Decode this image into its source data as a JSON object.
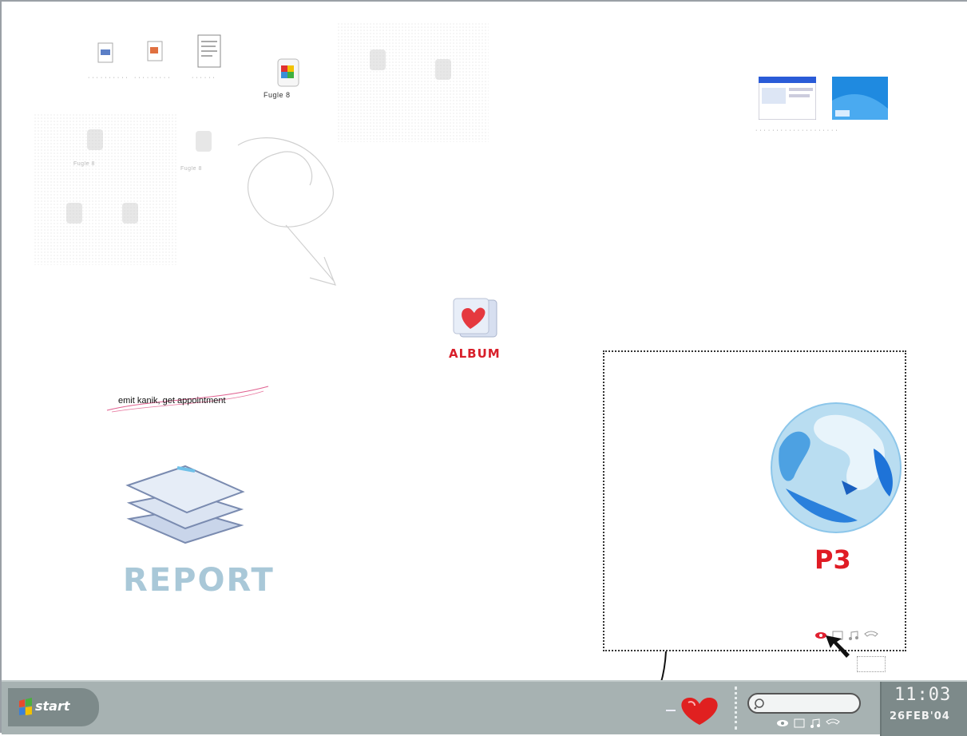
{
  "desktop": {
    "note": "emit kanik, get appointment",
    "album_label": "ALBUM",
    "report_label": "REPORT",
    "p3_label": "P3",
    "faded_label": "Fugle 8"
  },
  "taskbar": {
    "start_label": "start",
    "clock_time": "11:03",
    "clock_date": "26FEB'04"
  },
  "colors": {
    "album_red": "#d81f2a",
    "report_blue": "#a9c8d8",
    "taskbar_gray": "#a7b2b2",
    "globe_blue": "#7cc4ec"
  },
  "icons": [
    "windows-flag-icon",
    "heart-icon",
    "globe-icon",
    "document-stack-icon",
    "eye-icon",
    "music-icon",
    "phone-icon",
    "search-icon"
  ]
}
